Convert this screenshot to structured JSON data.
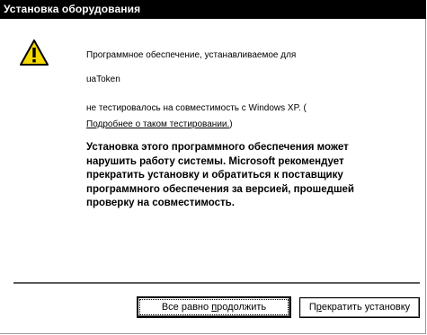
{
  "window": {
    "title": "Установка оборудования"
  },
  "icons": {
    "warning": "warning-triangle-icon"
  },
  "message": {
    "line1": "Программное обеспечение, устанавливаемое для",
    "device": "uaToken",
    "line3": "не тестировалось на совместимость с Windows XP. (",
    "link": "Подробнее о таком тестировании.",
    "link_close": ")",
    "warning_lines": [
      "Установка этого программного обеспечения может",
      "нарушить работу системы. Microsoft рекомендует",
      "прекратить установку и обратиться к поставщику",
      "программного обеспечения за версией, прошедшей",
      "проверку на совместимость."
    ]
  },
  "buttons": {
    "continue_prefix": "Все равно ",
    "continue_accel": "п",
    "continue_rest": "родолжить",
    "stop_prefix": "П",
    "stop_accel": "р",
    "stop_rest": "екратить установку"
  },
  "colors": {
    "titlebar": "#000000",
    "background": "#ffffff",
    "icon": "#f5d800"
  }
}
